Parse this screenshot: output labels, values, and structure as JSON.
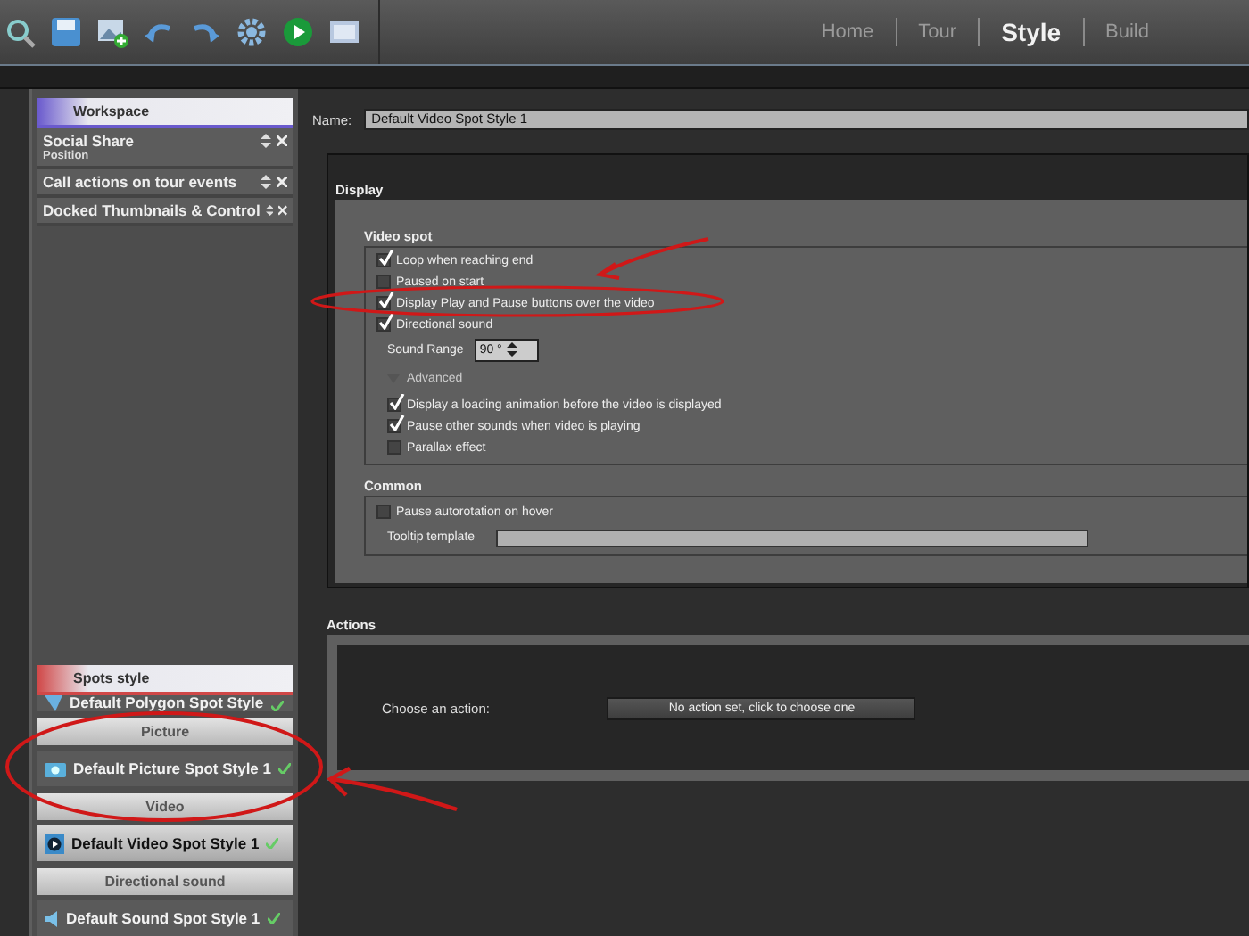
{
  "toolbar": {
    "tabs": [
      {
        "label": "Home",
        "selected": false
      },
      {
        "label": "Tour",
        "selected": false
      },
      {
        "label": "Style",
        "selected": true
      },
      {
        "label": "Build",
        "selected": false
      }
    ]
  },
  "workspace": {
    "title": "Workspace",
    "panels": [
      {
        "title": "Social Share",
        "subtitle": "Position"
      },
      {
        "title": "Call actions on tour events"
      },
      {
        "title": "Docked Thumbnails & Control"
      }
    ]
  },
  "spots_style": {
    "title": "Spots style",
    "items": [
      {
        "kind": "polygon",
        "label": "Default Polygon Spot Style",
        "selected": false
      },
      {
        "kind": "header",
        "label": "Picture"
      },
      {
        "kind": "picture",
        "label": "Default Picture Spot Style 1",
        "selected": false
      },
      {
        "kind": "header",
        "label": "Video"
      },
      {
        "kind": "video",
        "label": "Default Video Spot Style 1",
        "selected": true
      },
      {
        "kind": "header",
        "label": "Directional sound"
      },
      {
        "kind": "sound",
        "label": "Default Sound Spot Style 1",
        "selected": false
      }
    ]
  },
  "name_field": {
    "label": "Name:",
    "value": "Default Video Spot Style 1"
  },
  "display": {
    "title": "Display",
    "video_spot": {
      "title": "Video spot",
      "options": [
        {
          "label": "Loop when reaching end",
          "checked": true
        },
        {
          "label": "Paused on start",
          "checked": false
        },
        {
          "label": "Display Play and Pause buttons over the video",
          "checked": true
        },
        {
          "label": "Directional sound",
          "checked": true
        }
      ],
      "sound_range": {
        "label": "Sound Range",
        "value": "90 °"
      },
      "advanced": {
        "label": "Advanced",
        "options": [
          {
            "label": "Display a loading animation before the video is displayed",
            "checked": true
          },
          {
            "label": "Pause other sounds when video is playing",
            "checked": true
          },
          {
            "label": "Parallax effect",
            "checked": false
          }
        ]
      }
    },
    "common": {
      "title": "Common",
      "options": [
        {
          "label": "Pause autorotation on hover",
          "checked": false
        }
      ],
      "tooltip": {
        "label": "Tooltip template"
      }
    }
  },
  "actions": {
    "title": "Actions",
    "label": "Choose an action:",
    "button": "No action set, click to choose one"
  }
}
